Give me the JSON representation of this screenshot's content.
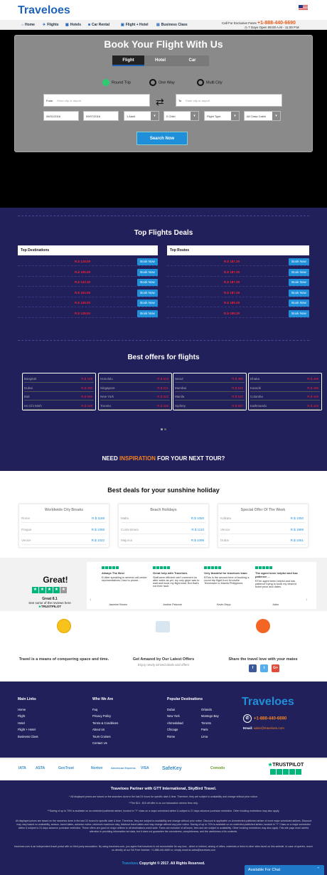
{
  "header": {
    "logo": "Travelоes",
    "nav": [
      {
        "label": "Home",
        "icon": "home-icon"
      },
      {
        "label": "Flights",
        "icon": "plane-icon"
      },
      {
        "label": "Hotels",
        "icon": "hotel-icon"
      },
      {
        "label": "Car Rental",
        "icon": "car-icon"
      },
      {
        "label": "Flight + Hotel",
        "icon": "flight-hotel-icon"
      },
      {
        "label": "Business Class",
        "icon": "briefcase-icon"
      }
    ],
    "call_label": "Call For Exclusive Fares",
    "phone": "+1-888-440-6690",
    "hours": "7 Days Open 09:00 A.M - 11:00 P.M"
  },
  "search": {
    "title": "Book Your Flight With Us",
    "tabs": [
      "Flight",
      "Hotel",
      "Car"
    ],
    "trip_types": [
      "Round Trip",
      "One Way",
      "Multi City"
    ],
    "from_label": "From",
    "from_placeholder": "Enter city or airport",
    "to_label": "To",
    "to_placeholder": "Enter city or airport",
    "depart_date": "08/31/2016",
    "return_date": "09/07/2016",
    "adults": "1 Adult",
    "children": "0 Child",
    "flight_type": "Flight Type",
    "cabin": "All Class Cabin",
    "button": "Search Now"
  },
  "top_deals": {
    "title": "Top Flights Deals",
    "destinations_header": "Top Destinations",
    "routes_header": "Top Routes",
    "destinations": [
      {
        "price": "R.$ 128.09",
        "book": "Book Now"
      },
      {
        "price": "R.$ 108.09",
        "book": "Book Now"
      },
      {
        "price": "R.$ 123.19",
        "book": "Book Now"
      },
      {
        "price": "R.$ 153.09",
        "book": "Book Now"
      },
      {
        "price": "R.$ 128.00",
        "book": "Book Now"
      },
      {
        "price": "R.$ 128.00",
        "book": "Book Now"
      }
    ],
    "routes": [
      {
        "price": "R.$ 187.39",
        "book": "Book Now"
      },
      {
        "price": "R.$ 187.39",
        "book": "Book Now"
      },
      {
        "price": "R.$ 187.39",
        "book": "Book Now"
      },
      {
        "price": "R.$ 187.39",
        "book": "Book Now"
      },
      {
        "price": "R.$ 189.39",
        "book": "Book Now"
      },
      {
        "price": "R.$ 189.39",
        "book": "Book Now"
      }
    ]
  },
  "best_offers": {
    "title": "Best offers for flights",
    "cards": [
      [
        {
          "city": "Bangkok",
          "price": "R.$ 449"
        },
        {
          "city": "Dubai",
          "price": "R.$ 400"
        },
        {
          "city": "Bali",
          "price": "R.$ 585"
        },
        {
          "city": "Ho Chi Minh",
          "price": "R.$ 449"
        }
      ],
      [
        {
          "city": "Honolulu",
          "price": "R.$ 518"
        },
        {
          "city": "Singapore",
          "price": "R.$ 521"
        },
        {
          "city": "New York",
          "price": "R.$ 522"
        },
        {
          "city": "Toronto",
          "price": "R.$ 449"
        }
      ],
      [
        {
          "city": "Seoul",
          "price": "R.$ 486"
        },
        {
          "city": "Mumbai",
          "price": "R.$ 545"
        },
        {
          "city": "Manila",
          "price": "R.$ 510"
        },
        {
          "city": "Sydney",
          "price": "R.$ 597"
        }
      ],
      [
        {
          "city": "Dhaka",
          "price": "R.$ 449"
        },
        {
          "city": "Karachi",
          "price": "R.$ 469"
        },
        {
          "city": "Colombo",
          "price": "R.$ 449"
        },
        {
          "city": "Kathmandu",
          "price": "R.$ 449"
        }
      ]
    ],
    "inspiration_pre": "NEED ",
    "inspiration_hl": "INSPIRATION",
    "inspiration_post": " FOR YOUR NEXT TOUR?"
  },
  "sunshine": {
    "title": "Best deals for your sunshine holiday",
    "cards": [
      {
        "title": "Worldwide City Breaks",
        "rows": [
          {
            "city": "Rome",
            "price": "R.$ 1188"
          },
          {
            "city": "Prague",
            "price": "R.$ 1088"
          },
          {
            "city": "Venice",
            "price": "R.$ 1022"
          }
        ]
      },
      {
        "title": "Beach Holidays",
        "rows": [
          {
            "city": "Malta",
            "price": "R.$ 1050"
          },
          {
            "city": "Costa Brava",
            "price": "R.$ 1110"
          },
          {
            "city": "Majorca",
            "price": "R.$ 1099"
          }
        ]
      },
      {
        "title": "Special Offer Of The Week",
        "rows": [
          {
            "city": "Kolkata",
            "price": "R.$ 1050"
          },
          {
            "city": "Venice",
            "price": "R.$ 1999"
          },
          {
            "city": "Dubai",
            "price": "R.$ 1061"
          }
        ]
      }
    ]
  },
  "trustpilot": {
    "great": "Great!",
    "score": "Great 8.1",
    "see": "See some of the reviews here",
    "brand": "TRUSTPILOT",
    "reviews": [
      {
        "title": "Always The Best",
        "body": "Ð After speaking to several call center representatives I had to phone...",
        "author": "Jasmine Brown"
      },
      {
        "title": "Great help with Travelоes",
        "body": "Staff were efficient can't comment on after sales as yet, my only gripe was to wait and book my flight seat. But that's not their fault.",
        "author": "Justine Palcone"
      },
      {
        "title": "Very thankful for travelоes team",
        "body": "ÐThis is the second time of booking a round trip flight from Knoxville Tennessee to Manila Philippines.",
        "author": "Kevin Depp"
      },
      {
        "title": "The agent been helpful and has patience ...",
        "body": "ÐThe agent been helpful and has patience trying to book my desired ticket price and dates.",
        "author": "Jobin"
      }
    ]
  },
  "features": [
    {
      "title": "Travel is a means of conquering space and time.",
      "sub": ""
    },
    {
      "title": "Get Amazed by Our Latest Offers",
      "sub": "Enjoy newly arrived deals and offers"
    },
    {
      "title": "Share the travel love with your mates",
      "sub": ""
    }
  ],
  "footer": {
    "main_links_title": "Main Links",
    "main_links": [
      "Home",
      "Flight",
      "Hotel",
      "Flight + Hotel",
      "Business Class"
    ],
    "who_title": "Who We Are",
    "who_links": [
      "Faq",
      "Privacy Policy",
      "Terms & Conditions",
      "About Us",
      "Tours Cruises",
      "Contact Us"
    ],
    "popular_title": "Popular Destinations",
    "popular_col1": [
      "Dubai",
      "New York",
      "Ahmedabad",
      "Chicago",
      "Rome"
    ],
    "popular_col2": [
      "Orlando",
      "Montego Bay",
      "Toronto",
      "Paris",
      "Lima"
    ],
    "logo": "Travelоes",
    "phone": "+1-888-440-6690",
    "email_label": "Email:",
    "email": "sales@travelоes.com"
  },
  "partners": [
    "IATA",
    "ASTA",
    "GeoTrust",
    "Norton",
    "American Express",
    "VISA",
    "SafeKey",
    "Comodo",
    "TRUSTPILOT"
  ],
  "disclaimer": {
    "title": "Travelоes Partner with GTT International, SkyBird Travel.",
    "p1": "* All displayed prices are based on the searches done in the last 24 hours for specific date & time. Therefore, they are subject to availability and change without prior notice.",
    "p2": "**The $10 - $15 off offer is on our transaction service fees only.",
    "p3": "**Saving of up to 70% is available on un-restricted published airfare, booked in \"Y\" class on a major scheduled airline & subject to 21 days advance purchase restriction. Other booking restrictions may also apply.",
    "p4": "All displayed prices are based on the searches done in the last 24 hours for specific date & time. Therefore, they are subject to availability and change without prior notice. Discount is applicable on Unrestricted published airfare of most major scheduled airlines. Discount may vary based on availability, season, travel dates, advance notice, minimum maximum stay, blackout travel dates and may change without any prior notice. Saving of up to 70% is available on un-restricted published airfare, booked in \"Y\" Class on a major scheduled airline & subject to 21 days advance purchase restriction. These offers are good on major airlines to all destinations world-wide. Fares are inclusive of all taxes, fees and are subject to availability. Other booking restrictions may also apply. This site pays most careful attention in providing information but data, but it does not guarantee the correctness, completeness, and the usefulness of its contents.",
    "p5": "travelоes.com is an independent travel portal with no third party association. By using travelоes.com, you agree that travelоes is not accountable for any loss - direct or indirect, arising of offers, materials or links to other sites found on this website. In case of queries, reach us directly at our Toll Free Number: +1-888-440-6690 or, simply email at sales@travelоes.com",
    "copy_brand": "Travelоes",
    "copy": "Copyright © 2017. All Rights Reserved."
  },
  "chat": {
    "label": "Available For Chat"
  }
}
